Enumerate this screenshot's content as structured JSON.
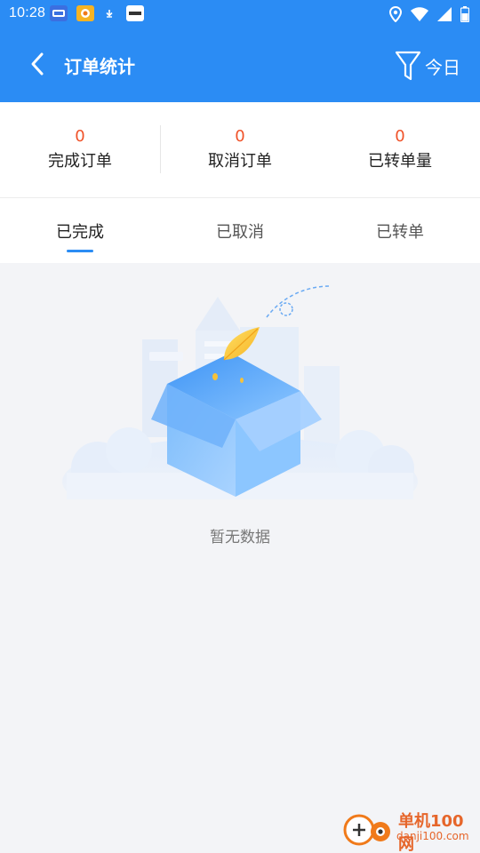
{
  "status_bar": {
    "time": "10:28",
    "app_icons": [
      "ad-app-icon",
      "game-app-icon",
      "download-icon",
      "browser-app-icon"
    ],
    "indicators": [
      "location-icon",
      "wifi-icon",
      "signal-icon",
      "battery-icon"
    ]
  },
  "header": {
    "title": "订单统计",
    "filter_label": "今日",
    "accent": "#2b8cf4"
  },
  "stats": [
    {
      "value": "0",
      "label": "完成订单"
    },
    {
      "value": "0",
      "label": "取消订单"
    },
    {
      "value": "0",
      "label": "已转单量"
    }
  ],
  "tabs": [
    {
      "label": "已完成",
      "active": true
    },
    {
      "label": "已取消",
      "active": false
    },
    {
      "label": "已转单",
      "active": false
    }
  ],
  "empty_state": {
    "text": "暂无数据",
    "icon": "empty-box-illustration"
  },
  "watermark": {
    "main": "单机100网",
    "sub": "danji100.com"
  },
  "colors": {
    "stat_value": "#f0532a",
    "background": "#f3f4f7"
  }
}
